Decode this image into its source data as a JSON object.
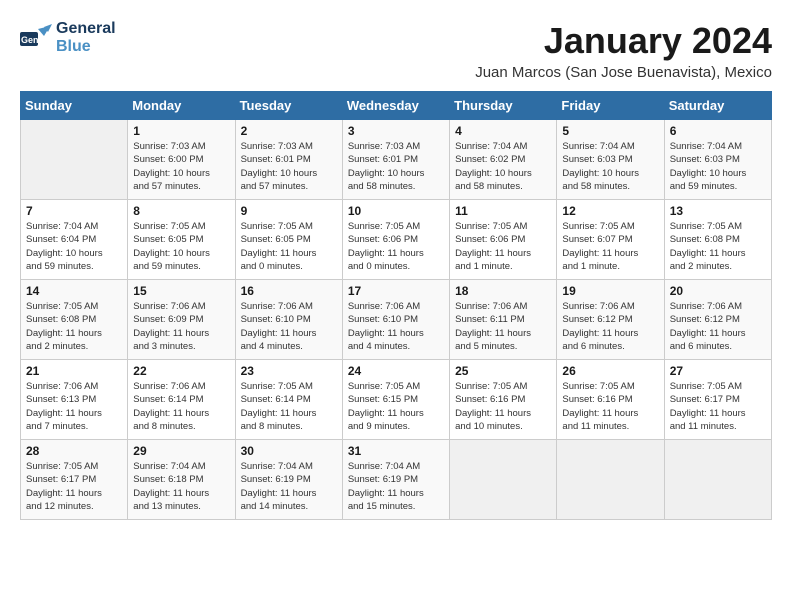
{
  "header": {
    "logo_line1": "General",
    "logo_line2": "Blue",
    "title": "January 2024",
    "subtitle": "Juan Marcos (San Jose Buenavista), Mexico"
  },
  "days_of_week": [
    "Sunday",
    "Monday",
    "Tuesday",
    "Wednesday",
    "Thursday",
    "Friday",
    "Saturday"
  ],
  "weeks": [
    [
      {
        "day": "",
        "info": ""
      },
      {
        "day": "1",
        "info": "Sunrise: 7:03 AM\nSunset: 6:00 PM\nDaylight: 10 hours\nand 57 minutes."
      },
      {
        "day": "2",
        "info": "Sunrise: 7:03 AM\nSunset: 6:01 PM\nDaylight: 10 hours\nand 57 minutes."
      },
      {
        "day": "3",
        "info": "Sunrise: 7:03 AM\nSunset: 6:01 PM\nDaylight: 10 hours\nand 58 minutes."
      },
      {
        "day": "4",
        "info": "Sunrise: 7:04 AM\nSunset: 6:02 PM\nDaylight: 10 hours\nand 58 minutes."
      },
      {
        "day": "5",
        "info": "Sunrise: 7:04 AM\nSunset: 6:03 PM\nDaylight: 10 hours\nand 58 minutes."
      },
      {
        "day": "6",
        "info": "Sunrise: 7:04 AM\nSunset: 6:03 PM\nDaylight: 10 hours\nand 59 minutes."
      }
    ],
    [
      {
        "day": "7",
        "info": "Sunrise: 7:04 AM\nSunset: 6:04 PM\nDaylight: 10 hours\nand 59 minutes."
      },
      {
        "day": "8",
        "info": "Sunrise: 7:05 AM\nSunset: 6:05 PM\nDaylight: 10 hours\nand 59 minutes."
      },
      {
        "day": "9",
        "info": "Sunrise: 7:05 AM\nSunset: 6:05 PM\nDaylight: 11 hours\nand 0 minutes."
      },
      {
        "day": "10",
        "info": "Sunrise: 7:05 AM\nSunset: 6:06 PM\nDaylight: 11 hours\nand 0 minutes."
      },
      {
        "day": "11",
        "info": "Sunrise: 7:05 AM\nSunset: 6:06 PM\nDaylight: 11 hours\nand 1 minute."
      },
      {
        "day": "12",
        "info": "Sunrise: 7:05 AM\nSunset: 6:07 PM\nDaylight: 11 hours\nand 1 minute."
      },
      {
        "day": "13",
        "info": "Sunrise: 7:05 AM\nSunset: 6:08 PM\nDaylight: 11 hours\nand 2 minutes."
      }
    ],
    [
      {
        "day": "14",
        "info": "Sunrise: 7:05 AM\nSunset: 6:08 PM\nDaylight: 11 hours\nand 2 minutes."
      },
      {
        "day": "15",
        "info": "Sunrise: 7:06 AM\nSunset: 6:09 PM\nDaylight: 11 hours\nand 3 minutes."
      },
      {
        "day": "16",
        "info": "Sunrise: 7:06 AM\nSunset: 6:10 PM\nDaylight: 11 hours\nand 4 minutes."
      },
      {
        "day": "17",
        "info": "Sunrise: 7:06 AM\nSunset: 6:10 PM\nDaylight: 11 hours\nand 4 minutes."
      },
      {
        "day": "18",
        "info": "Sunrise: 7:06 AM\nSunset: 6:11 PM\nDaylight: 11 hours\nand 5 minutes."
      },
      {
        "day": "19",
        "info": "Sunrise: 7:06 AM\nSunset: 6:12 PM\nDaylight: 11 hours\nand 6 minutes."
      },
      {
        "day": "20",
        "info": "Sunrise: 7:06 AM\nSunset: 6:12 PM\nDaylight: 11 hours\nand 6 minutes."
      }
    ],
    [
      {
        "day": "21",
        "info": "Sunrise: 7:06 AM\nSunset: 6:13 PM\nDaylight: 11 hours\nand 7 minutes."
      },
      {
        "day": "22",
        "info": "Sunrise: 7:06 AM\nSunset: 6:14 PM\nDaylight: 11 hours\nand 8 minutes."
      },
      {
        "day": "23",
        "info": "Sunrise: 7:05 AM\nSunset: 6:14 PM\nDaylight: 11 hours\nand 8 minutes."
      },
      {
        "day": "24",
        "info": "Sunrise: 7:05 AM\nSunset: 6:15 PM\nDaylight: 11 hours\nand 9 minutes."
      },
      {
        "day": "25",
        "info": "Sunrise: 7:05 AM\nSunset: 6:16 PM\nDaylight: 11 hours\nand 10 minutes."
      },
      {
        "day": "26",
        "info": "Sunrise: 7:05 AM\nSunset: 6:16 PM\nDaylight: 11 hours\nand 11 minutes."
      },
      {
        "day": "27",
        "info": "Sunrise: 7:05 AM\nSunset: 6:17 PM\nDaylight: 11 hours\nand 11 minutes."
      }
    ],
    [
      {
        "day": "28",
        "info": "Sunrise: 7:05 AM\nSunset: 6:17 PM\nDaylight: 11 hours\nand 12 minutes."
      },
      {
        "day": "29",
        "info": "Sunrise: 7:04 AM\nSunset: 6:18 PM\nDaylight: 11 hours\nand 13 minutes."
      },
      {
        "day": "30",
        "info": "Sunrise: 7:04 AM\nSunset: 6:19 PM\nDaylight: 11 hours\nand 14 minutes."
      },
      {
        "day": "31",
        "info": "Sunrise: 7:04 AM\nSunset: 6:19 PM\nDaylight: 11 hours\nand 15 minutes."
      },
      {
        "day": "",
        "info": ""
      },
      {
        "day": "",
        "info": ""
      },
      {
        "day": "",
        "info": ""
      }
    ]
  ]
}
